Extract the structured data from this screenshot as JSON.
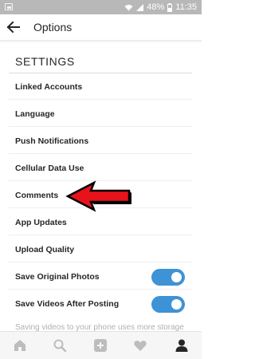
{
  "status_bar": {
    "battery": "48%",
    "time": "11:35"
  },
  "app_bar": {
    "title": "Options"
  },
  "settings": {
    "section_title": "SETTINGS",
    "items": [
      {
        "label": "Linked Accounts"
      },
      {
        "label": "Language"
      },
      {
        "label": "Push Notifications"
      },
      {
        "label": "Cellular Data Use"
      },
      {
        "label": "Comments"
      },
      {
        "label": "App Updates"
      },
      {
        "label": "Upload Quality"
      },
      {
        "label": "Save Original Photos",
        "toggle": "on"
      },
      {
        "label": "Save Videos After Posting",
        "toggle": "on"
      }
    ],
    "helper_text": "Saving videos to your phone uses more storage"
  },
  "annotation": {
    "arrow_color": "#e8131a",
    "points_to": "Comments"
  },
  "tab_bar": {
    "tabs": [
      "home-icon",
      "search-icon",
      "add-post-icon",
      "activity-heart-icon",
      "profile-icon"
    ],
    "active": "profile-icon"
  },
  "colors": {
    "toggle_on": "#3d93d5",
    "status_bar": "#b8b8b8",
    "text": "#262626"
  }
}
